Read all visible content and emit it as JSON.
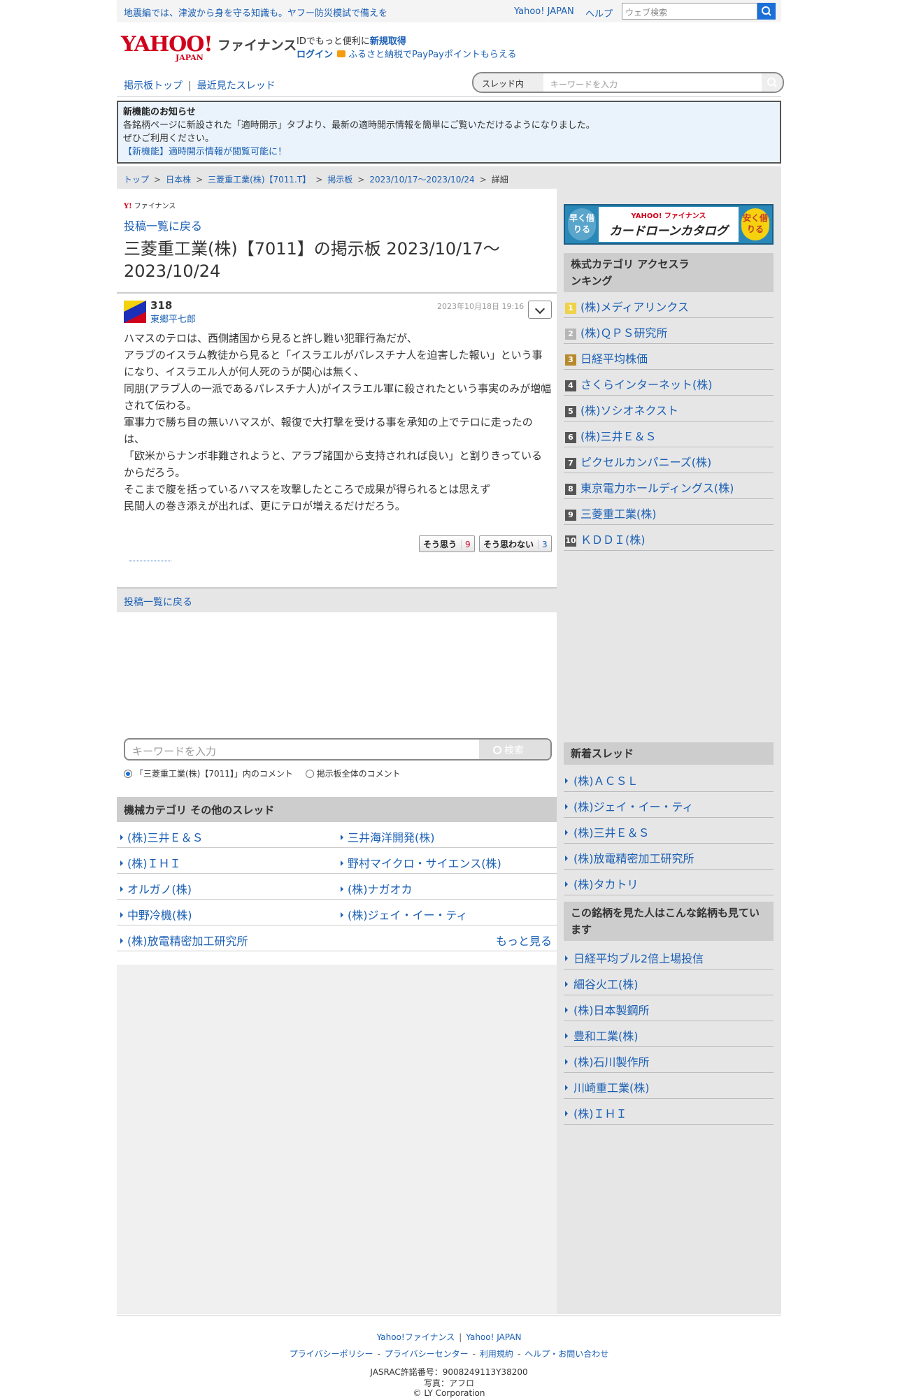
{
  "topbar": {
    "notice": "地震編では、津波から身を守る知識も。ヤフー防災模試で備えを",
    "yahoo_japan": "Yahoo! JAPAN",
    "help": "ヘルプ",
    "web_search_placeholder": "ウェブ検索"
  },
  "header": {
    "logo_yahoo": "YAHOO!",
    "logo_japan": "JAPAN",
    "logo_finance": "ファイナンス",
    "id_text": "IDでもっと便利に",
    "signup": "新規取得",
    "login": "ログイン",
    "furusato": "ふるさと納税でPayPayポイントもらえる"
  },
  "nav": {
    "board_top": "掲示板トップ",
    "recent": "最近見たスレッド",
    "scope": "スレッド内",
    "keyword_placeholder": "キーワードを入力"
  },
  "news": {
    "heading": "新機能のお知らせ",
    "line1": "各銘柄ページに新設された「適時開示」タブより、最新の適時開示情報を簡単にご覧いただけるようになりました。",
    "line2": "ぜひご利用ください。",
    "link": "【新機能】適時開示情報が閲覧可能に！"
  },
  "breadcrumb": [
    "トップ",
    "日本株",
    "三菱重工業(株)【7011.T】",
    "掲示板",
    "2023/10/17〜2023/10/24",
    "詳細"
  ],
  "post": {
    "fin_small": "ファイナンス",
    "back": "投稿一覧に戻る",
    "title": "三菱重工業(株)【7011】の掲示板 2023/10/17〜2023/10/24",
    "number": "318",
    "author": "東郷平七郎",
    "date": "2023年10月18日 19:16",
    "lines": [
      "ハマスのテロは、西側諸国から見ると許し難い犯罪行為だが、",
      "アラブのイスラム教徒から見ると「イスラエルがパレスチナ人を迫害した報い」という事になり、イスラエル人が何人死のうが関心は無く、",
      "同朋(アラブ人の一派であるパレスチナ人)がイスラエル軍に殺されたという事実のみが増幅されて伝わる。",
      "軍事力で勝ち目の無いハマスが、報復で大打撃を受ける事を承知の上でテロに走ったのは、",
      "「欧米からナンボ非難されようと、アラブ諸国から支持されれば良い」と割りきっているからだろう。",
      "そこまで腹を括っているハマスを攻撃したところで成果が得られるとは思えず",
      "民間人の巻き添えが出れば、更にテロが増えるだけだろう。"
    ],
    "agree_label": "そう思う",
    "agree_count": "9",
    "disagree_label": "そう思わない",
    "disagree_count": "3",
    "back_bottom": "投稿一覧に戻る"
  },
  "search2": {
    "placeholder": "キーワードを入力",
    "button": "検索",
    "radio1": "「三菱重工業(株)【7011】」内のコメント",
    "radio2": "掲示板全体のコメント"
  },
  "other_threads": {
    "heading": "機械カテゴリ その他のスレッド",
    "items": [
      "(株)三井Ｅ＆Ｓ",
      "三井海洋開発(株)",
      "(株)ＩＨＩ",
      "野村マイクロ・サイエンス(株)",
      "オルガノ(株)",
      "(株)ナガオカ",
      "中野冷機(株)",
      "(株)ジェイ・イー・ティ",
      "(株)放電精密加工研究所"
    ],
    "more": "もっと見る"
  },
  "sidebar": {
    "banner_left": "早く借りる",
    "banner_logo": "YAHOO! ファイナンス",
    "banner_title": "カードローンカタログ",
    "banner_right": "安く借りる",
    "ranking_heading": "株式カテゴリ アクセスランキング",
    "ranking": [
      {
        "rank": "1",
        "name": "(株)メディアリンクス"
      },
      {
        "rank": "2",
        "name": "(株)ＱＰＳ研究所"
      },
      {
        "rank": "3",
        "name": "日経平均株価"
      },
      {
        "rank": "4",
        "name": "さくらインターネット(株)"
      },
      {
        "rank": "5",
        "name": "(株)ソシオネクスト"
      },
      {
        "rank": "6",
        "name": "(株)三井Ｅ＆Ｓ"
      },
      {
        "rank": "7",
        "name": "ピクセルカンパニーズ(株)"
      },
      {
        "rank": "8",
        "name": "東京電力ホールディングス(株)"
      },
      {
        "rank": "9",
        "name": "三菱重工業(株)"
      },
      {
        "rank": "10",
        "name": "ＫＤＤＩ(株)"
      }
    ],
    "new_heading": "新着スレッド",
    "new_threads": [
      "(株)ＡＣＳＬ",
      "(株)ジェイ・イー・ティ",
      "(株)三井Ｅ＆Ｓ",
      "(株)放電精密加工研究所",
      "(株)タカトリ"
    ],
    "also_heading": "この銘柄を見た人はこんな銘柄も見ています",
    "also": [
      "日経平均ブル2倍上場投信",
      "細谷火工(株)",
      "(株)日本製鋼所",
      "豊和工業(株)",
      "(株)石川製作所",
      "川崎重工業(株)",
      "(株)ＩＨＩ"
    ]
  },
  "footer": {
    "yf": "Yahoo!ファイナンス",
    "yj": "Yahoo! JAPAN",
    "privacy_policy": "プライバシーポリシー",
    "privacy_center": "プライバシーセンター",
    "terms": "利用規約",
    "help": "ヘルプ・お問い合わせ",
    "jasrac": "JASRAC許諾番号：9008249113Y38200",
    "photo": "写真：アフロ",
    "copyright": "© LY Corporation"
  }
}
